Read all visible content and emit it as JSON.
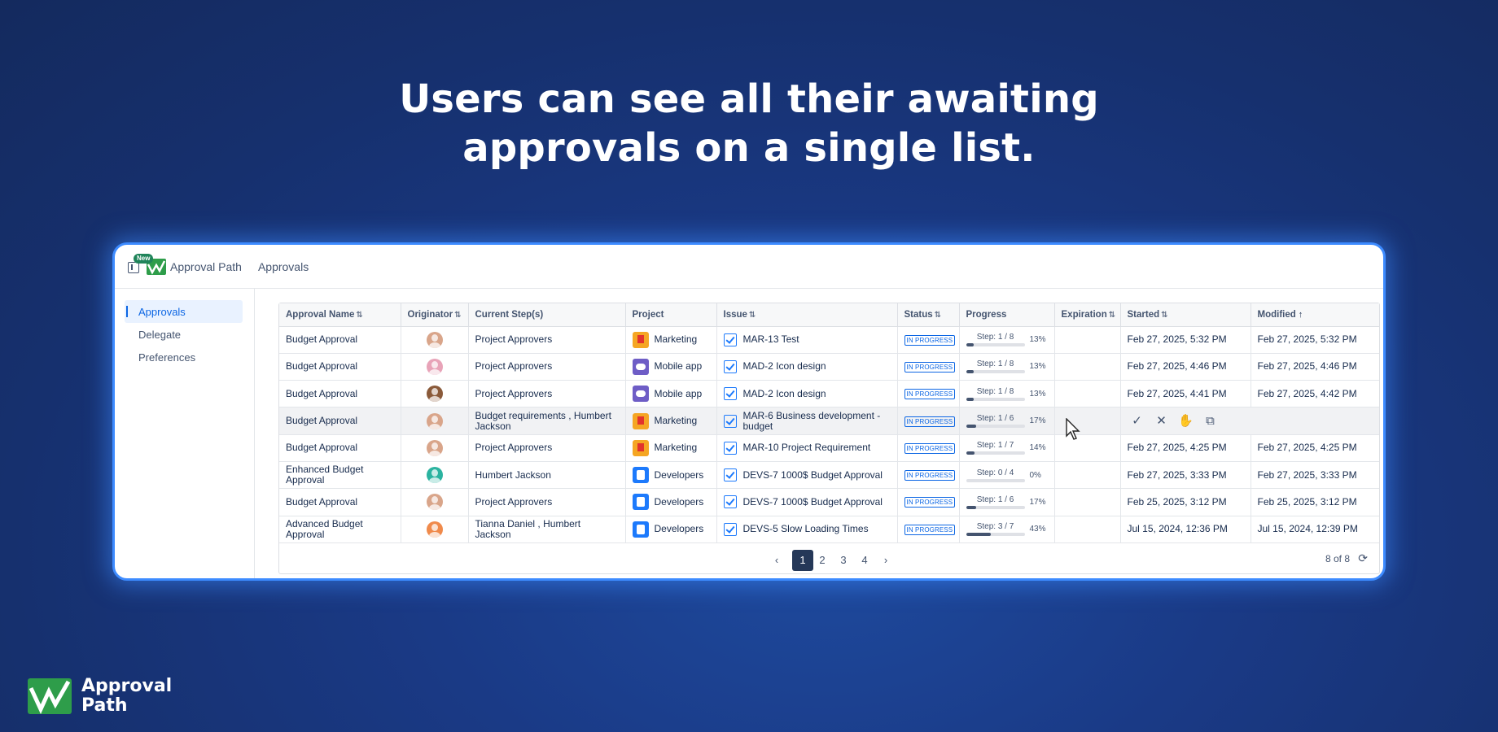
{
  "headline": {
    "line1": "Users can see all their awaiting",
    "line2": "approvals on a single list."
  },
  "app": {
    "new_badge": "New",
    "name": "Approval Path",
    "breadcrumb": "Approvals"
  },
  "sidebar": {
    "items": [
      {
        "label": "Approvals",
        "active": true
      },
      {
        "label": "Delegate"
      },
      {
        "label": "Preferences"
      }
    ]
  },
  "table": {
    "columns": {
      "approval_name": "Approval Name",
      "originator": "Originator",
      "current_steps": "Current Step(s)",
      "project": "Project",
      "issue": "Issue",
      "status": "Status",
      "progress": "Progress",
      "expiration": "Expiration",
      "started": "Started",
      "modified": "Modified"
    },
    "rows": [
      {
        "name": "Budget Approval",
        "avatar_color": "#d9a58a",
        "step": "Project Approvers",
        "project": "Marketing",
        "project_icon": "mk",
        "issue": "MAR-13 Test",
        "status": "IN PROGRESS",
        "progress_label": "Step: 1 / 8",
        "progress": 13,
        "pct": "13%",
        "expiration": "",
        "started": "Feb 27, 2025, 5:32 PM",
        "modified": "Feb 27, 2025, 5:32 PM"
      },
      {
        "name": "Budget Approval",
        "avatar_color": "#e8a3b8",
        "step": "Project Approvers",
        "project": "Mobile app",
        "project_icon": "mb",
        "issue": "MAD-2 Icon design",
        "status": "IN PROGRESS",
        "progress_label": "Step: 1 / 8",
        "progress": 13,
        "pct": "13%",
        "expiration": "",
        "started": "Feb 27, 2025, 4:46 PM",
        "modified": "Feb 27, 2025, 4:46 PM"
      },
      {
        "name": "Budget Approval",
        "avatar_color": "#8a5a3a",
        "step": "Project Approvers",
        "project": "Mobile app",
        "project_icon": "mb",
        "issue": "MAD-2 Icon design",
        "status": "IN PROGRESS",
        "progress_label": "Step: 1 / 8",
        "progress": 13,
        "pct": "13%",
        "expiration": "",
        "started": "Feb 27, 2025, 4:41 PM",
        "modified": "Feb 27, 2025, 4:42 PM"
      },
      {
        "name": "Budget Approval",
        "avatar_color": "#d9a58a",
        "step": "Budget requirements , Humbert Jackson",
        "project": "Marketing",
        "project_icon": "mk",
        "issue": "MAR-6 Business development - budget",
        "status": "IN PROGRESS",
        "progress_label": "Step: 1 / 6",
        "progress": 17,
        "pct": "17%",
        "expiration": "",
        "started": "",
        "modified": "",
        "hover": true
      },
      {
        "name": "Budget Approval",
        "avatar_color": "#d9a58a",
        "step": "Project Approvers",
        "project": "Marketing",
        "project_icon": "mk",
        "issue": "MAR-10 Project Requirement",
        "status": "IN PROGRESS",
        "progress_label": "Step: 1 / 7",
        "progress": 14,
        "pct": "14%",
        "expiration": "",
        "started": "Feb 27, 2025, 4:25 PM",
        "modified": "Feb 27, 2025, 4:25 PM"
      },
      {
        "name": "Enhanced Budget Approval",
        "avatar_color": "#2bb3a0",
        "step": "Humbert Jackson",
        "project": "Developers",
        "project_icon": "dv",
        "issue": "DEVS-7 1000$ Budget Approval",
        "status": "IN PROGRESS",
        "progress_label": "Step: 0 / 4",
        "progress": 0,
        "pct": "0%",
        "expiration": "",
        "started": "Feb 27, 2025, 3:33 PM",
        "modified": "Feb 27, 2025, 3:33 PM"
      },
      {
        "name": "Budget Approval",
        "avatar_color": "#d9a58a",
        "step": "Project Approvers",
        "project": "Developers",
        "project_icon": "dv",
        "issue": "DEVS-7 1000$ Budget Approval",
        "status": "IN PROGRESS",
        "progress_label": "Step: 1 / 6",
        "progress": 17,
        "pct": "17%",
        "expiration": "",
        "started": "Feb 25, 2025, 3:12 PM",
        "modified": "Feb 25, 2025, 3:12 PM"
      },
      {
        "name": "Advanced Budget Approval",
        "avatar_color": "#f08a4b",
        "step": "Tianna Daniel , Humbert Jackson",
        "project": "Developers",
        "project_icon": "dv",
        "issue": "DEVS-5 Slow Loading Times",
        "status": "IN PROGRESS",
        "progress_label": "Step: 3 / 7",
        "progress": 43,
        "pct": "43%",
        "expiration": "",
        "started": "Jul 15, 2024, 12:36 PM",
        "modified": "Jul 15, 2024, 12:39 PM"
      }
    ],
    "row_actions": [
      {
        "icon": "check-icon",
        "glyph": "✓"
      },
      {
        "icon": "close-icon",
        "glyph": "✕"
      },
      {
        "icon": "hand-icon",
        "glyph": "✋"
      },
      {
        "icon": "open-external-icon",
        "glyph": "⧉"
      }
    ]
  },
  "pagination": {
    "prev": "‹",
    "pages": [
      "1",
      "2",
      "3",
      "4"
    ],
    "current": "1",
    "next": "›",
    "count": "8 of 8",
    "refresh": "⟳"
  },
  "brand": {
    "line1": "Approval",
    "line2": "Path"
  },
  "colors": {
    "accent": "#0c66e4",
    "glow": "#3d8bff",
    "background": "#1a3a86"
  }
}
